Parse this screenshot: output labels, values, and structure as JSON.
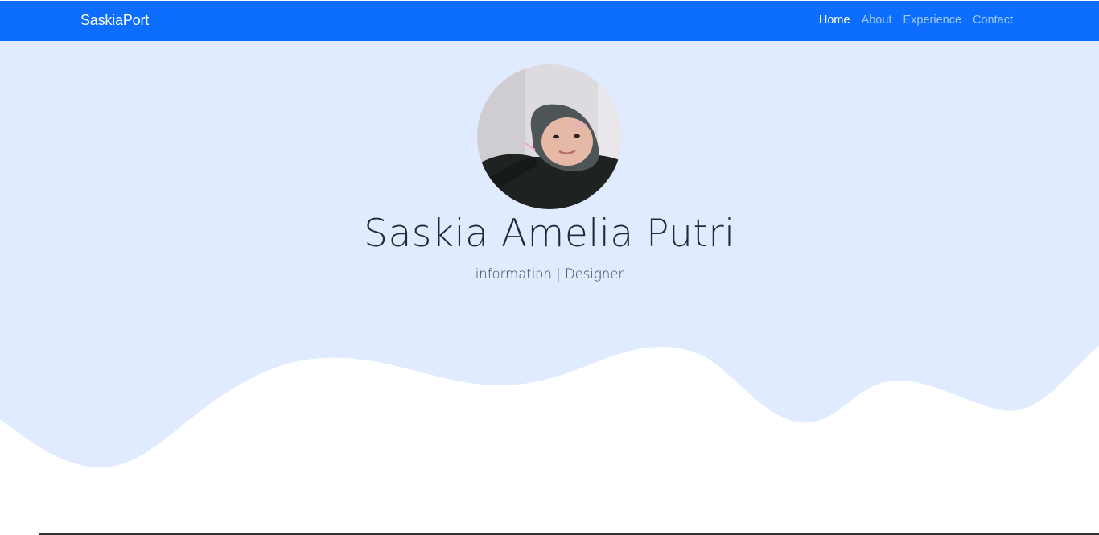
{
  "navbar": {
    "brand": "SaskiaPort",
    "links": [
      {
        "label": "Home",
        "active": true
      },
      {
        "label": "About",
        "active": false
      },
      {
        "label": "Experience",
        "active": false
      },
      {
        "label": "Contact",
        "active": false
      }
    ]
  },
  "hero": {
    "name": "Saskia Amelia Putri",
    "subtitle": "information | Designer",
    "avatar_alt": "profile-photo"
  },
  "colors": {
    "primary": "#0d6efd",
    "hero_bg": "#e0ebff",
    "text": "#1f2b3d"
  }
}
